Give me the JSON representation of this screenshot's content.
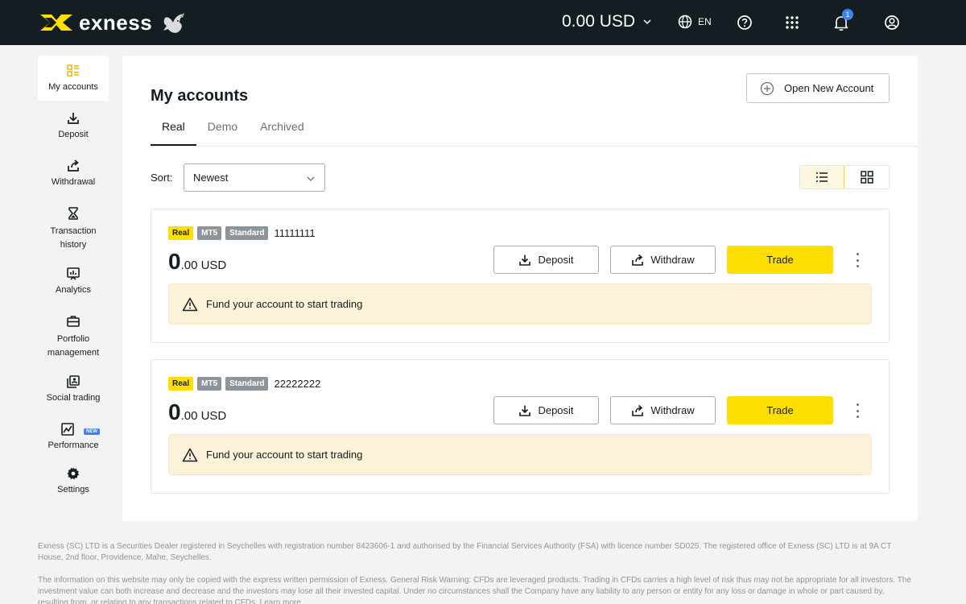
{
  "brand": {
    "name": "exness"
  },
  "header": {
    "balance": "0.00 USD",
    "language": "EN",
    "notification_count": "1"
  },
  "sidebar": {
    "items": [
      {
        "label": "My accounts",
        "icon": "accounts-grid-icon"
      },
      {
        "label": "Deposit",
        "icon": "deposit-icon"
      },
      {
        "label": "Withdrawal",
        "icon": "withdrawal-icon"
      },
      {
        "label": "Transaction history",
        "icon": "hourglass-icon"
      },
      {
        "label": "Analytics",
        "icon": "analytics-icon"
      },
      {
        "label": "Portfolio management",
        "icon": "briefcase-icon"
      },
      {
        "label": "Social trading",
        "icon": "social-trading-icon"
      },
      {
        "label": "Performance",
        "icon": "performance-icon",
        "badge": "NEW"
      },
      {
        "label": "Settings",
        "icon": "gear-icon"
      }
    ]
  },
  "main": {
    "title": "My accounts",
    "open_account_label": "Open New Account",
    "tabs": [
      {
        "label": "Real",
        "active": true
      },
      {
        "label": "Demo",
        "active": false
      },
      {
        "label": "Archived",
        "active": false
      }
    ],
    "sort": {
      "label": "Sort:",
      "value": "Newest"
    },
    "view_mode": "list"
  },
  "accounts": [
    {
      "type_badge": "Real",
      "platform_badge": "MT5",
      "plan_badge": "Standard",
      "number": "11111111",
      "amount_whole": "0",
      "amount_decimal": ".00 USD",
      "deposit_label": "Deposit",
      "withdraw_label": "Withdraw",
      "trade_label": "Trade",
      "notice": "Fund your account to start trading"
    },
    {
      "type_badge": "Real",
      "platform_badge": "MT5",
      "plan_badge": "Standard",
      "number": "22222222",
      "amount_whole": "0",
      "amount_decimal": ".00 USD",
      "deposit_label": "Deposit",
      "withdraw_label": "Withdraw",
      "trade_label": "Trade",
      "notice": "Fund your account to start trading"
    }
  ],
  "footer": {
    "p1": "Exness (SC) LTD is a Securities Dealer registered in Seychelles with registration number 8423606-1 and authorised by the Financial Services Authority (FSA) with licence number SD025. The registered office of Exness (SC) LTD is at 9A CT House, 2nd floor, Providence, Mahe, Seychelles.",
    "p2": "The information on this website may only be copied with the express written permission of Exness. General Risk Warning: CFDs are leveraged products. Trading in CFDs carries a high level of risk thus may not be appropriate for all investors. The investment value can both increase and decrease and the investors may lose all their invested capital. Under no circumstances shall the Company have any liability to any person or entity for any loss or damage in whole or part caused by, resulting from, or relating to any transactions related to CFDs. Learn more"
  },
  "colors": {
    "header_bg": "#141d22",
    "accent_yellow": "#ffde02",
    "notice_bg": "#fcf1d9",
    "badge_blue": "#3b82f6"
  }
}
